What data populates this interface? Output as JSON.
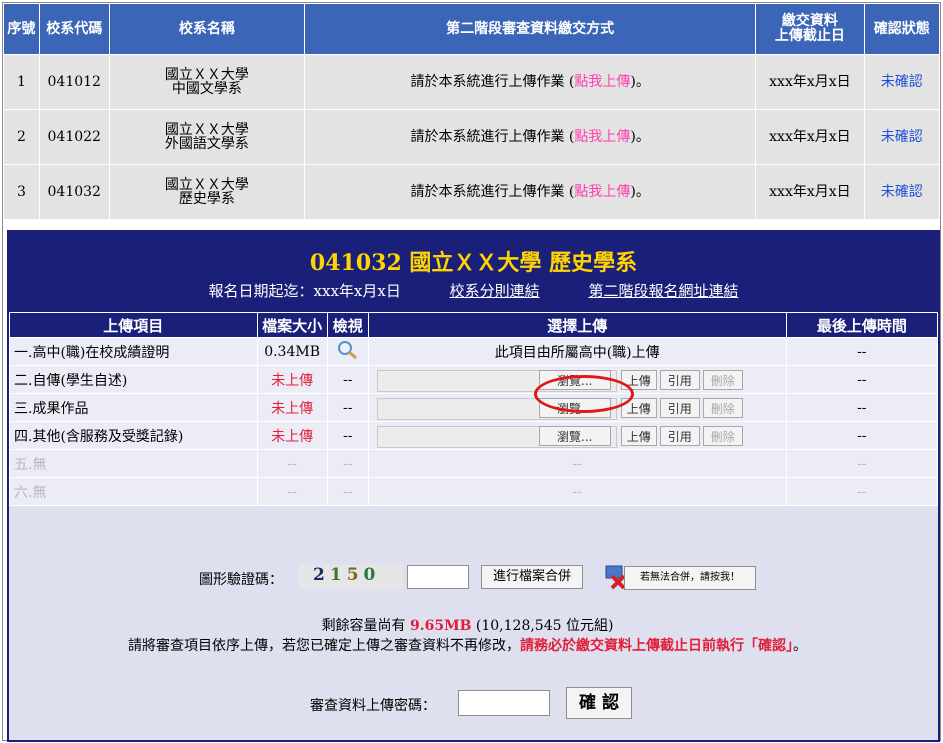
{
  "top_table": {
    "headers": [
      "序號",
      "校系代碼",
      "校系名稱",
      "第二階段審查資料繳交方式",
      "繳交資料",
      "上傳截止日",
      "確認狀態"
    ],
    "rows": [
      {
        "no": "1",
        "code": "041012",
        "school": "國立ＸＸ大學",
        "dept": "中國文學系",
        "method_prefix": "請於本系統進行上傳作業 (",
        "method_link": "點我上傳",
        "method_suffix": ")。",
        "deadline": "xxx年x月x日",
        "status": "未確認"
      },
      {
        "no": "2",
        "code": "041022",
        "school": "國立ＸＸ大學",
        "dept": "外國語文學系",
        "method_prefix": "請於本系統進行上傳作業 (",
        "method_link": "點我上傳",
        "method_suffix": ")。",
        "deadline": "xxx年x月x日",
        "status": "未確認"
      },
      {
        "no": "3",
        "code": "041032",
        "school": "國立ＸＸ大學",
        "dept": "歷史學系",
        "method_prefix": "請於本系統進行上傳作業 (",
        "method_link": "點我上傳",
        "method_suffix": ")。",
        "deadline": "xxx年x月x日",
        "status": "未確認"
      }
    ]
  },
  "panel": {
    "title": "041032 國立ＸＸ大學 歷史學系",
    "reg_period": "報名日期起迄：xxx年x月x日",
    "link_rules": "校系分則連結",
    "link_stage2": "第二階段報名網址連結",
    "headers": [
      "上傳項目",
      "檔案大小",
      "檢視",
      "選擇上傳",
      "最後上傳時間"
    ],
    "items": [
      {
        "name": "一.高中(職)在校成績證明",
        "size": "0.34MB",
        "view": "",
        "upload_text": "此項目由所屬高中(職)上傳",
        "last": "--"
      },
      {
        "name": "二.自傳(學生自述)",
        "size": "未上傳",
        "view": "--",
        "last": "--"
      },
      {
        "name": "三.成果作品",
        "size": "未上傳",
        "view": "--",
        "last": "--"
      },
      {
        "name": "四.其他(含服務及受獎記錄)",
        "size": "未上傳",
        "view": "--",
        "last": "--"
      },
      {
        "name": "五.無",
        "size": "--",
        "view": "--",
        "upload_text": "--",
        "last": "--"
      },
      {
        "name": "六.無",
        "size": "--",
        "view": "--",
        "upload_text": "--",
        "last": "--"
      }
    ],
    "buttons": {
      "browse": "瀏覽...",
      "upload": "上傳",
      "cite": "引用",
      "delete": "刪除"
    },
    "captcha_label": "圖形驗證碼：",
    "captcha_digits": [
      "2",
      "1",
      "5",
      "0"
    ],
    "merge_button": "進行檔案合併",
    "cannot_merge": "若無法合併，請按我！",
    "capacity_prefix": "剩餘容量尚有 ",
    "capacity_value": "9.65MB",
    "capacity_suffix": " (10,128,545 位元組)",
    "note_prefix": "請將審查項目依序上傳，若您已確定上傳之審查資料不再修改，",
    "note_emph": "請務必於繳交資料上傳截止日前執行「確認」",
    "note_suffix": "。",
    "password_label": "審查資料上傳密碼：",
    "confirm_button": "確 認"
  },
  "colors": {
    "header_blue": "#3b66b8",
    "navy": "#1a1f7a",
    "title_yellow": "#ffd400",
    "link_pink": "#ff3fb0",
    "status_blue": "#1f4fd6",
    "alert_red": "#e0203a"
  }
}
